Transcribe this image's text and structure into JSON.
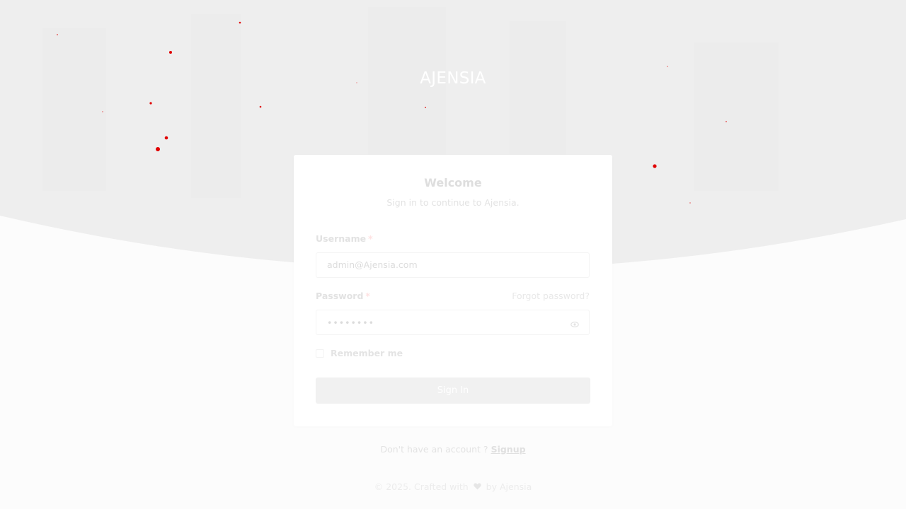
{
  "brand": {
    "name": "AJENSIA"
  },
  "login": {
    "title": "Welcome",
    "subtitle": "Sign in to continue to Ajensia.",
    "username": {
      "label": "Username",
      "required_mark": "*",
      "value": "admin@Ajensia.com"
    },
    "password": {
      "label": "Password",
      "required_mark": "*",
      "value": "••••••••",
      "forgot_link": "Forgot password?",
      "toggle_icon": "eye-icon"
    },
    "remember": {
      "label": "Remember me",
      "checked": false
    },
    "submit_label": "Sign In"
  },
  "signup": {
    "prompt": "Don't have an account ?",
    "link": "Signup"
  },
  "footer": {
    "prefix": "© 2025. Crafted with",
    "heart_icon": "heart-icon",
    "suffix": "by Ajensia"
  },
  "colors": {
    "hero_background": "#eeeeee",
    "page_background": "#fcfcfc",
    "card_background": "#ffffff",
    "button_background": "#f1f1f1",
    "particle": "#e00000"
  }
}
